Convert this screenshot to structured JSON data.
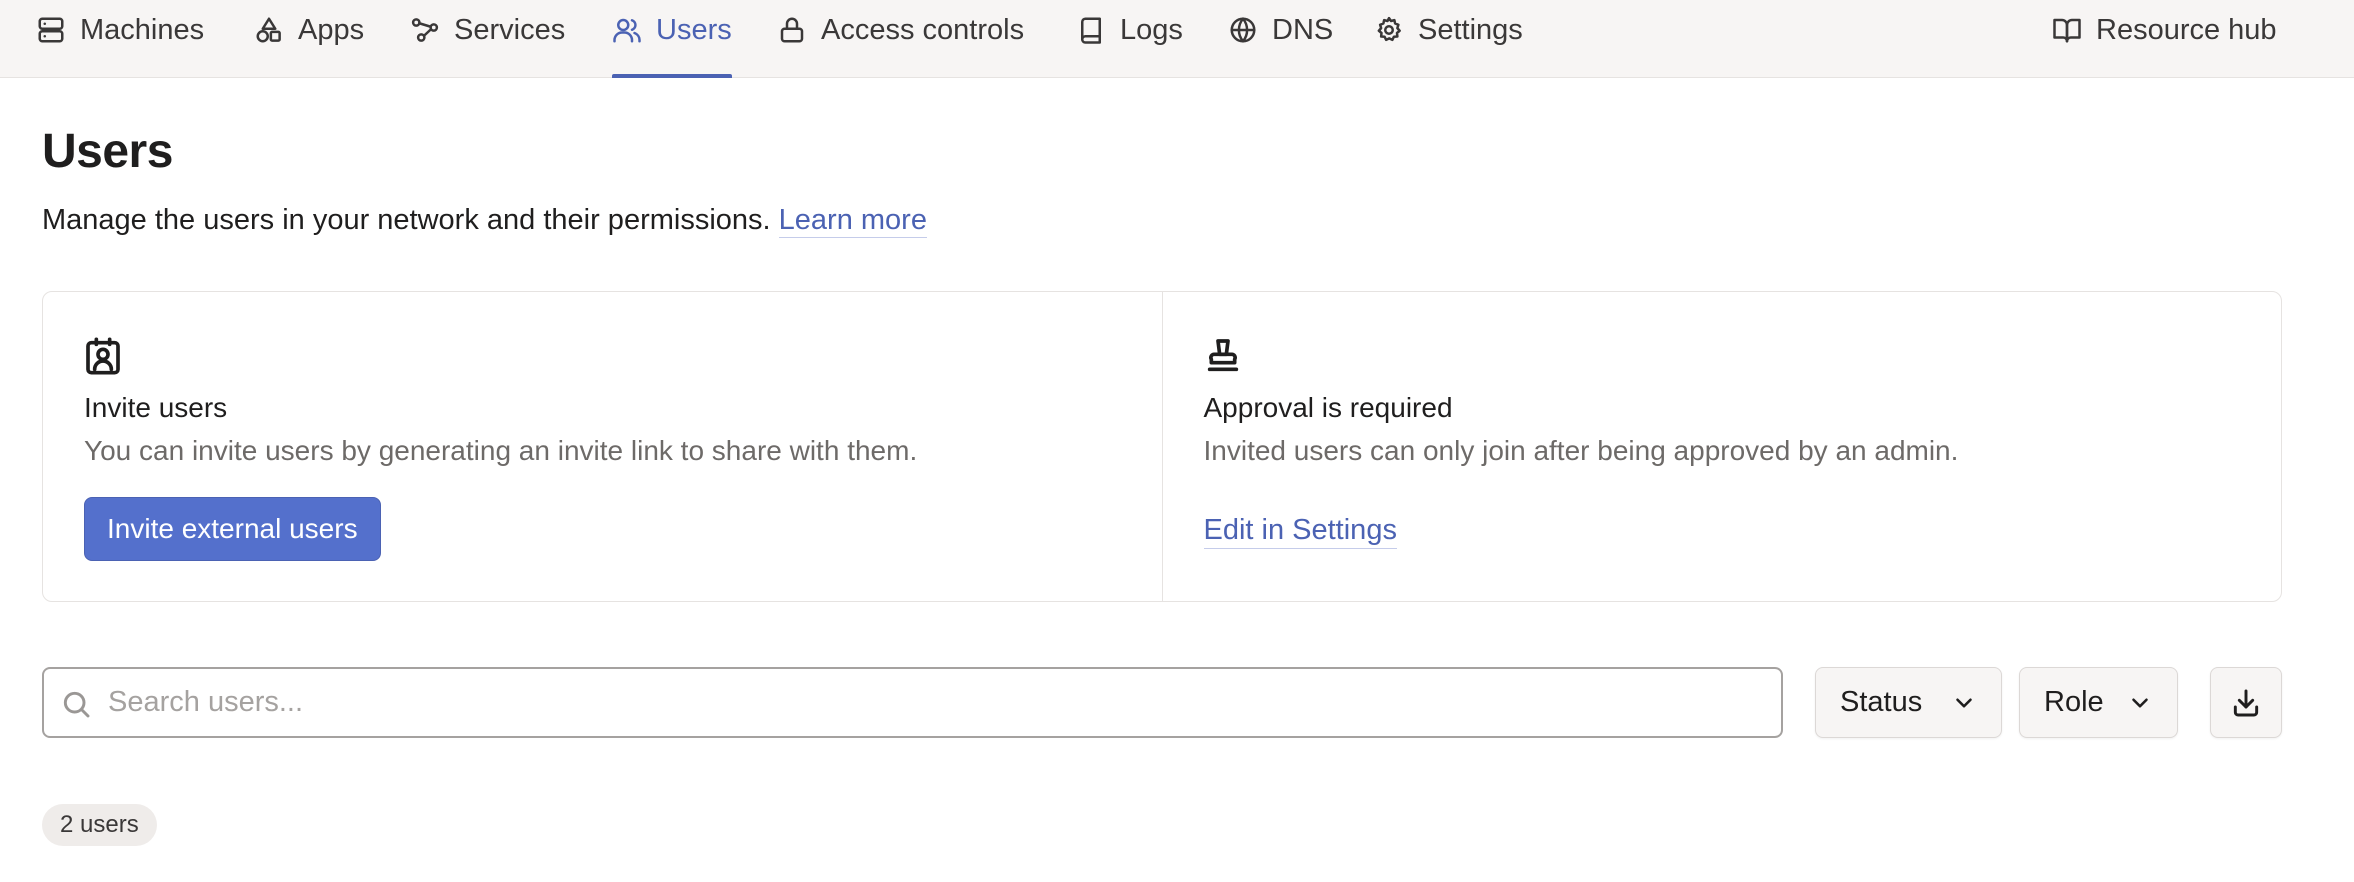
{
  "nav": {
    "items": [
      {
        "label": "Machines",
        "icon": "server-icon"
      },
      {
        "label": "Apps",
        "icon": "shapes-icon"
      },
      {
        "label": "Services",
        "icon": "services-icon"
      },
      {
        "label": "Users",
        "icon": "users-icon",
        "active": true
      },
      {
        "label": "Access controls",
        "icon": "lock-icon"
      },
      {
        "label": "Logs",
        "icon": "book-icon"
      },
      {
        "label": "DNS",
        "icon": "globe-icon"
      },
      {
        "label": "Settings",
        "icon": "gear-icon"
      }
    ],
    "resource_hub": {
      "label": "Resource hub",
      "icon": "book-open-icon"
    }
  },
  "header": {
    "title": "Users",
    "subtitle": "Manage the users in your network and their permissions.",
    "learn_more": "Learn more"
  },
  "cards": {
    "invite": {
      "icon": "contact-card-icon",
      "title": "Invite users",
      "description": "You can invite users by generating an invite link to share with them.",
      "button_label": "Invite external users"
    },
    "approval": {
      "icon": "stamp-icon",
      "title": "Approval is required",
      "description": "Invited users can only join after being approved by an admin.",
      "link_label": "Edit in Settings"
    }
  },
  "filters": {
    "search_placeholder": "Search users...",
    "search_value": "",
    "status_label": "Status",
    "role_label": "Role",
    "download_icon": "download-icon"
  },
  "summary": {
    "count_label": "2 users"
  },
  "colors": {
    "accent": "#4b62b3",
    "primary_button": "#5470cc",
    "nav_background": "#f7f5f4"
  }
}
